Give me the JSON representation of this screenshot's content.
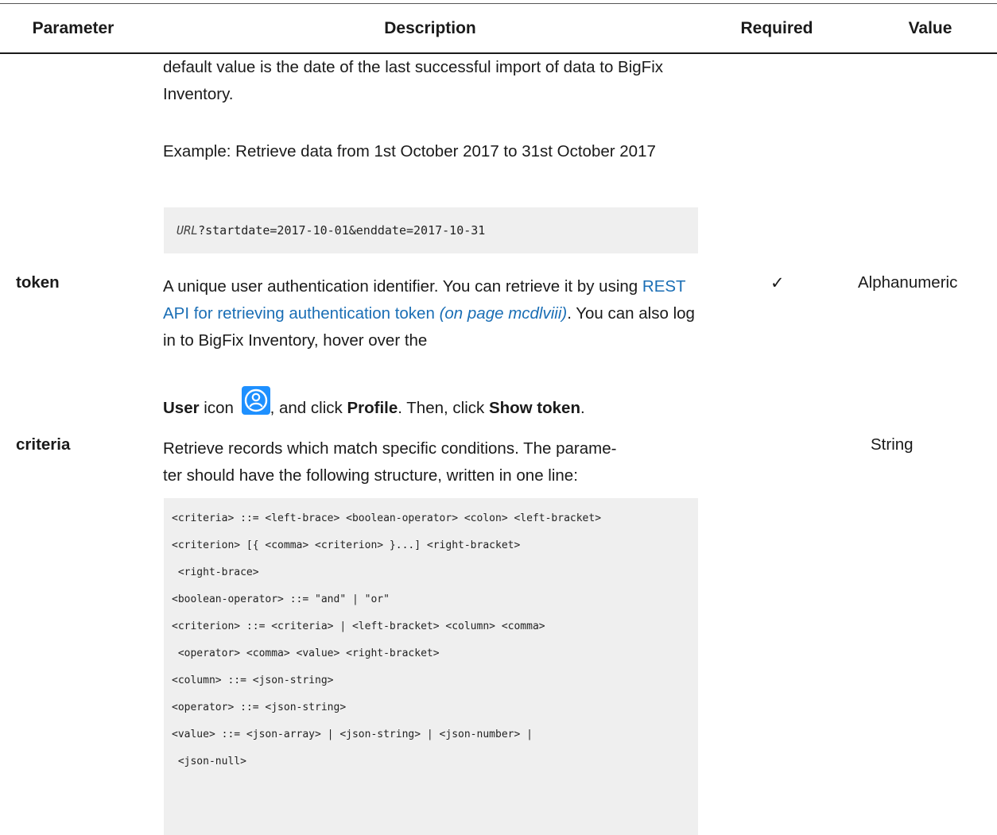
{
  "table": {
    "headers": {
      "parameter": "Parameter",
      "description": "Description",
      "required": "Required",
      "value": "Value"
    }
  },
  "rows": {
    "startdate": {
      "desc_cont": "default value is the date of the last successful import of data to BigFix Inventory.",
      "example_text": "Example: Retrieve data from 1st October 2017 to 31st October 2017",
      "example_code_url": "URL",
      "example_code_rest": "?startdate=2017-10-01&enddate=2017-10-31"
    },
    "token": {
      "name": "token",
      "desc_part1": "A unique user authentication identifier. You can retrieve it by using ",
      "link_text": "REST API for retrieving authentication token",
      "link_page": " (on page mcdlviii)",
      "desc_part2": ". You can also log in to BigFix Inventory, hover over the",
      "user_label": "User",
      "icon_word": " icon ",
      "icon_name": "user-profile-icon",
      "after_icon": ", and click ",
      "profile_label": "Profile",
      "then_click": ". Then, click ",
      "show_token_label": "Show token",
      "end_period": ".",
      "required": "✓",
      "value": "Alphanumeric"
    },
    "criteria": {
      "name": "criteria",
      "desc": "Retrieve records which match specific conditions. The parameter should have the following structure, written in one line:",
      "desc_line1": "Retrieve records which match specific conditions. The parame-",
      "desc_line2": "ter should have the following structure, written in one line:",
      "value": "String",
      "code_lines": [
        "<criteria> ::= <left-brace> <boolean-operator> <colon> <left-bracket>",
        "<criterion> [{ <comma> <criterion> }...] <right-bracket>",
        " <right-brace>",
        "<boolean-operator> ::= \"and\" | \"or\"",
        "<criterion> ::= <criteria> | <left-bracket> <column> <comma>",
        " <operator> <comma> <value> <right-bracket>",
        "<column> ::= <json-string>",
        "<operator> ::= <json-string>",
        "<value> ::= <json-array> | <json-string> | <json-number> |",
        " <json-null>"
      ]
    }
  },
  "colors": {
    "link": "#1a6eb5",
    "code_bg": "#efefef",
    "icon_bg": "#1e90ff"
  }
}
